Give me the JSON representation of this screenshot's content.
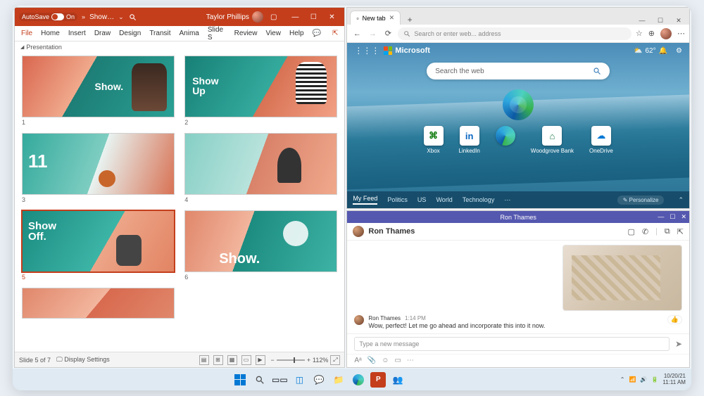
{
  "powerpoint": {
    "autosave_label": "AutoSave",
    "autosave_state": "On",
    "doc_title": "Show…",
    "user": "Taylor Phillips",
    "ribbon": [
      "File",
      "Home",
      "Insert",
      "Draw",
      "Design",
      "Transit",
      "Anima",
      "Slide S",
      "Review",
      "View",
      "Help"
    ],
    "breadcrumb": "Presentation",
    "slides": [
      {
        "n": "1",
        "t": "Show."
      },
      {
        "n": "2",
        "t": "Show\nUp"
      },
      {
        "n": "3",
        "t": "11"
      },
      {
        "n": "4",
        "t": ""
      },
      {
        "n": "5",
        "t": "Show\nOff."
      },
      {
        "n": "6",
        "t": "Show."
      }
    ],
    "status_slide": "Slide 5 of 7",
    "display_settings": "Display Settings",
    "zoom": "112%"
  },
  "edge": {
    "tab_title": "New tab",
    "addr_placeholder": "Search or enter web... address",
    "ms_label": "Microsoft",
    "temp": "62°",
    "search_placeholder": "Search the web",
    "tiles": [
      {
        "label": "Xbox"
      },
      {
        "label": "LinkedIn"
      },
      {
        "label": ""
      },
      {
        "label": "Woodgrove Bank"
      },
      {
        "label": "OneDrive"
      }
    ],
    "feed": [
      "My Feed",
      "Politics",
      "US",
      "World",
      "Technology"
    ],
    "personalize": "Personalize"
  },
  "teams": {
    "title": "Ron Thames",
    "contact": "Ron Thames",
    "msg_name": "Ron Thames",
    "msg_time": "1:14 PM",
    "msg_text": "Wow, perfect! Let me go ahead and incorporate this into it now.",
    "compose_placeholder": "Type a new message"
  },
  "taskbar": {
    "date": "10/20/21",
    "time": "11:11 AM"
  }
}
